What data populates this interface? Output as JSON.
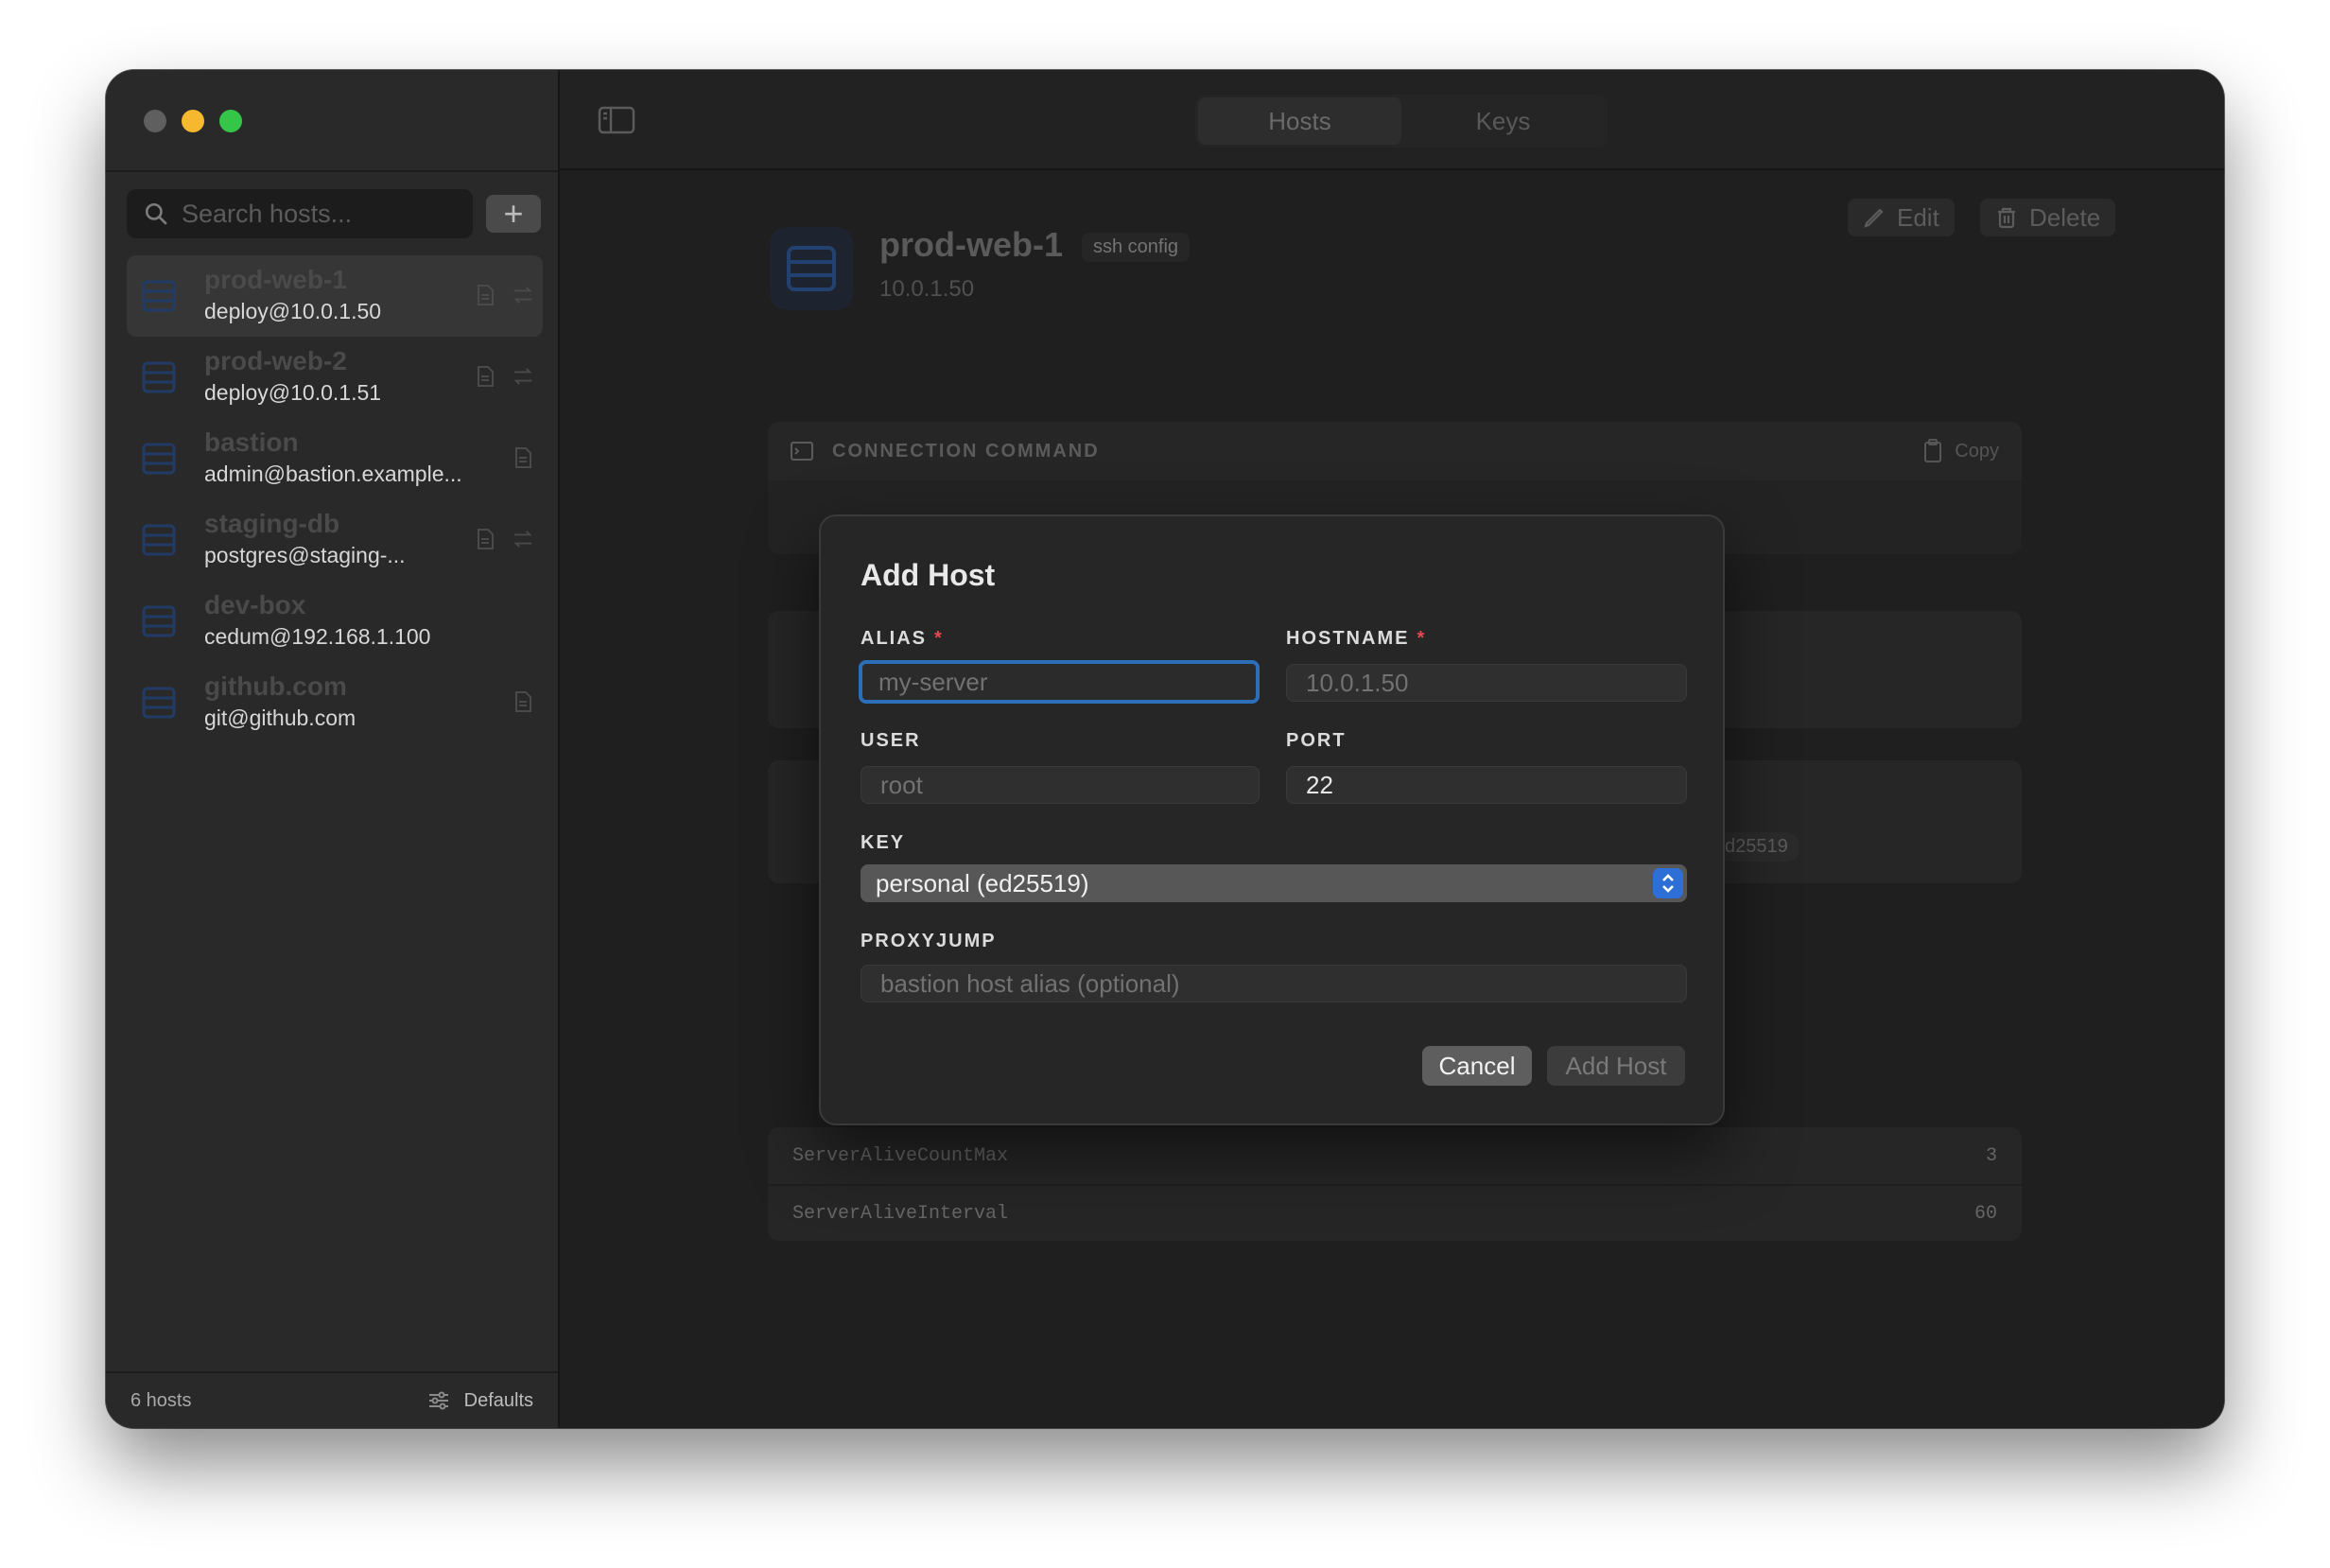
{
  "sidebar": {
    "search_placeholder": "Search hosts...",
    "hosts": [
      {
        "name": "prod-web-1",
        "address": "deploy@10.0.1.50",
        "selected": true
      },
      {
        "name": "prod-web-2",
        "address": "deploy@10.0.1.51"
      },
      {
        "name": "bastion",
        "address": "admin@bastion.example..."
      },
      {
        "name": "staging-db",
        "address": "postgres@staging-..."
      },
      {
        "name": "dev-box",
        "address": "cedum@192.168.1.100"
      },
      {
        "name": "github.com",
        "address": "git@github.com"
      }
    ],
    "footer": {
      "count": "6 hosts",
      "defaults_label": "Defaults"
    }
  },
  "toolbar": {
    "tabs": [
      "Hosts",
      "Keys"
    ],
    "active_tab": "Hosts"
  },
  "detail": {
    "name": "prod-web-1",
    "source_tag": "ssh config",
    "address": "10.0.1.50",
    "edit_label": "Edit",
    "delete_label": "Delete",
    "connection_title": "CONNECTION COMMAND",
    "copy_label": "Copy",
    "key_chip": "d25519",
    "options": [
      {
        "key": "ServerAliveCountMax",
        "value": "3"
      },
      {
        "key": "ServerAliveInterval",
        "value": "60"
      }
    ]
  },
  "modal": {
    "title": "Add Host",
    "alias": {
      "label": "ALIAS",
      "required": "*",
      "placeholder": "my-server",
      "value": ""
    },
    "hostname": {
      "label": "HOSTNAME",
      "required": "*",
      "placeholder": "10.0.1.50",
      "value": ""
    },
    "user": {
      "label": "USER",
      "placeholder": "root",
      "value": ""
    },
    "port": {
      "label": "PORT",
      "value": "22"
    },
    "key": {
      "label": "KEY",
      "selected": "personal (ed25519)"
    },
    "proxyjump": {
      "label": "PROXYJUMP",
      "placeholder": "bastion host alias (optional)",
      "value": ""
    },
    "cancel_label": "Cancel",
    "add_label": "Add Host"
  },
  "colors": {
    "accent": "#2a6fb7",
    "required": "#e5484d",
    "close": "#5f5f5f",
    "minimize": "#f5b82f",
    "maximize": "#35c649"
  }
}
